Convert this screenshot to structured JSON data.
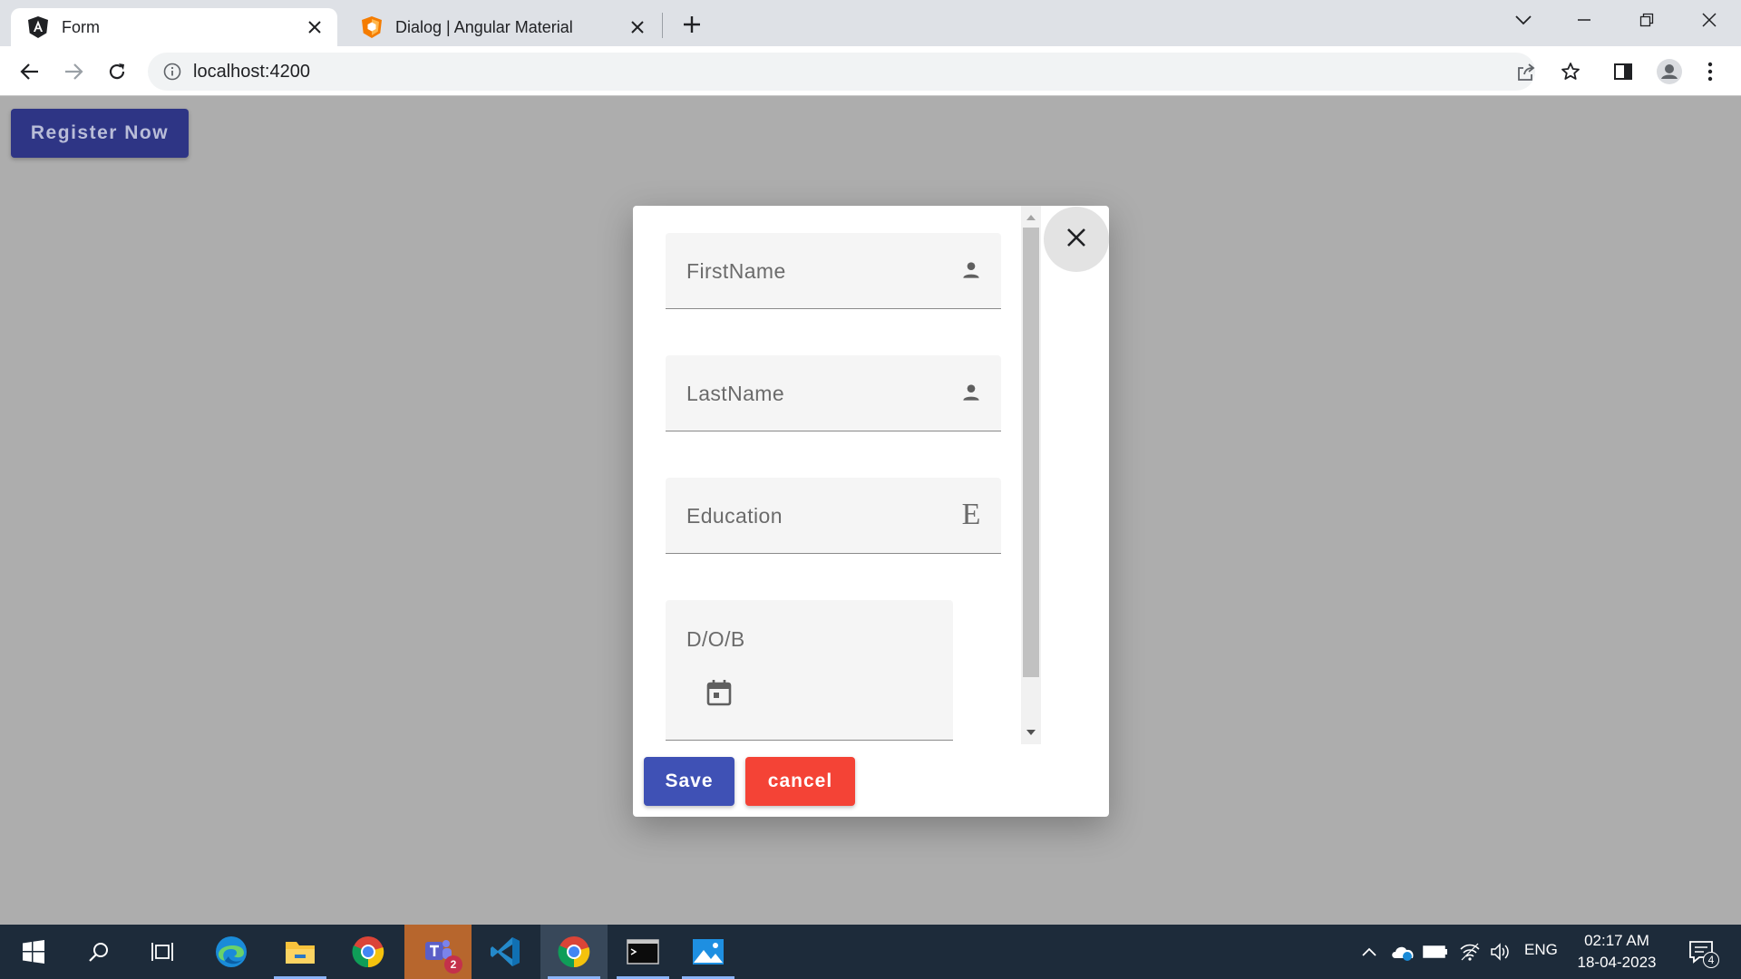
{
  "browser": {
    "tabs": [
      {
        "title": "Form",
        "active": true,
        "icon": "angular-icon"
      },
      {
        "title": "Dialog | Angular Material",
        "active": false,
        "icon": "angular-material-icon"
      }
    ],
    "url": "localhost:4200"
  },
  "page": {
    "register_button": "Register Now"
  },
  "dialog": {
    "fields": {
      "firstname": {
        "label": "FirstName",
        "icon": "person-icon"
      },
      "lastname": {
        "label": "LastName",
        "icon": "person-icon"
      },
      "education": {
        "label": "Education",
        "icon_text": "E"
      },
      "dob": {
        "label": "D/O/B",
        "icon": "calendar-icon"
      }
    },
    "save_label": "Save",
    "cancel_label": "cancel"
  },
  "taskbar": {
    "language": "ENG",
    "time": "02:17 AM",
    "date": "18-04-2023",
    "teams_badge": "2",
    "notification_count": "4"
  },
  "colors": {
    "primary": "#3f51b5",
    "warn": "#f44336",
    "overlay": "#adadad",
    "register_button": "#2e3585"
  }
}
